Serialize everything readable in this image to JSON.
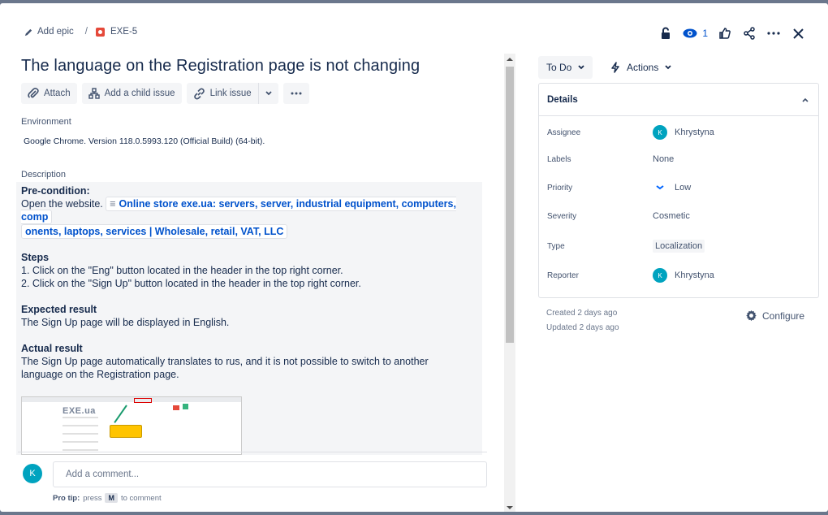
{
  "breadcrumb": {
    "add_epic": "Add epic",
    "separator": "/",
    "issue_key": "EXE-5"
  },
  "header": {
    "watch_count": "1"
  },
  "issue": {
    "title": "The language on the Registration page is not changing",
    "toolbar": {
      "attach": "Attach",
      "add_child": "Add a child issue",
      "link_issue": "Link issue"
    },
    "environment_label": "Environment",
    "environment_text": "Google Chrome. Version 118.0.5993.120 (Official Build) (64-bit).",
    "description_label": "Description",
    "description": {
      "precondition_title": "Pre-condition:",
      "precondition_text": "Open the website.",
      "link_line1": "Online store exe.ua: servers, server, industrial equipment, computers, comp",
      "link_line2": "onents, laptops, services | Wholesale, retail, VAT, LLC",
      "steps_title": "Steps",
      "step1": "1. Click on the \"Eng\" button located in the header in the top right corner.",
      "step2": "2. Click on the \"Sign Up\" button located in the header in the top right corner.",
      "expected_title": "Expected result",
      "expected_text": "The Sign Up page will be displayed in English.",
      "actual_title": "Actual result",
      "actual_line1": "The Sign Up page automatically translates to rus, and it is not possible to switch to another",
      "actual_line2": "language on the Registration page."
    }
  },
  "comment": {
    "avatar": "K",
    "placeholder": "Add a comment...",
    "protip_label": "Pro tip:",
    "protip_press": "press",
    "protip_key": "M",
    "protip_suffix": "to comment"
  },
  "sidebar": {
    "status": "To Do",
    "actions": "Actions",
    "details_title": "Details",
    "fields": {
      "assignee": {
        "label": "Assignee",
        "avatar": "K",
        "value": "Khrystyna"
      },
      "labels": {
        "label": "Labels",
        "value": "None"
      },
      "priority": {
        "label": "Priority",
        "value": "Low"
      },
      "severity": {
        "label": "Severity",
        "value": "Cosmetic"
      },
      "type": {
        "label": "Type",
        "value": "Localization"
      },
      "reporter": {
        "label": "Reporter",
        "avatar": "K",
        "value": "Khrystyna"
      }
    },
    "created": "Created 2 days ago",
    "updated": "Updated 2 days ago",
    "configure": "Configure"
  },
  "colors": {
    "accent": "#0052cc",
    "avatar": "#00a3bf",
    "bug": "#e5493a"
  }
}
